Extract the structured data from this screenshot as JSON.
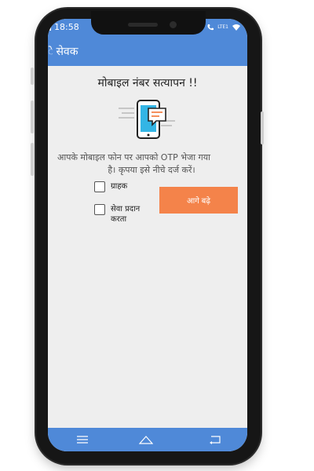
{
  "status_bar": {
    "time": "18:58",
    "network_label": "LTE1"
  },
  "app_bar": {
    "title_visible": "सेवक",
    "title_clipped_char": "े"
  },
  "screen": {
    "heading": "मोबाइल नंबर सत्यापन !!",
    "message_line1": "आपके मोबाइल फोन पर आपको OTP भेजा गया",
    "message_line2": "है। कृपया इसे नीचे दर्ज करें।",
    "checkbox_customer": "ग्राहक",
    "checkbox_provider": "सेवा प्रदान करता",
    "next_button": "आगे बढ़े"
  },
  "icons": {
    "signal": "signal-icon",
    "wifi": "wifi-icon",
    "call": "call-icon",
    "menu": "menu-icon",
    "home": "home-icon",
    "back": "back-icon",
    "phone_message": "phone-message-illustration"
  },
  "colors": {
    "app_blue": "#4f89d8",
    "accent_orange": "#f4834a",
    "screen_bg": "#eeeeee"
  }
}
